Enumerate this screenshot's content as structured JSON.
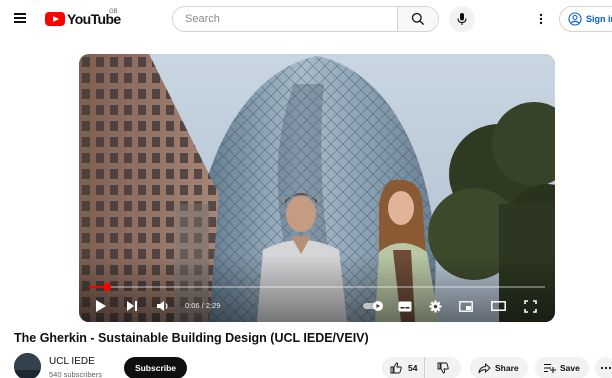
{
  "header": {
    "logo_text": "YouTube",
    "region": "GB",
    "search_placeholder": "Search",
    "signin_label": "Sign in"
  },
  "player": {
    "time_current": "0:06",
    "time_total": "2:29",
    "progress_fraction": 0.04
  },
  "video": {
    "title": "The Gherkin - Sustainable Building Design (UCL IEDE/VEIV)"
  },
  "channel": {
    "name": "UCL IEDE",
    "subscribers": "540 subscribers",
    "subscribe_label": "Subscribe"
  },
  "actions": {
    "like_count": "54",
    "share_label": "Share",
    "save_label": "Save"
  },
  "colors": {
    "brand_red": "#ff0000",
    "link_blue": "#065fd4",
    "pill_bg": "#f2f2f2"
  },
  "icons": [
    "menu-icon",
    "youtube-logo",
    "search-icon",
    "mic-icon",
    "more-vertical-icon",
    "account-icon",
    "play-icon",
    "next-icon",
    "volume-icon",
    "autoplay-toggle",
    "captions-icon",
    "settings-icon",
    "miniplayer-icon",
    "theater-icon",
    "fullscreen-icon",
    "thumb-up-icon",
    "thumb-down-icon",
    "share-icon",
    "save-playlist-icon",
    "more-horizontal-icon"
  ]
}
